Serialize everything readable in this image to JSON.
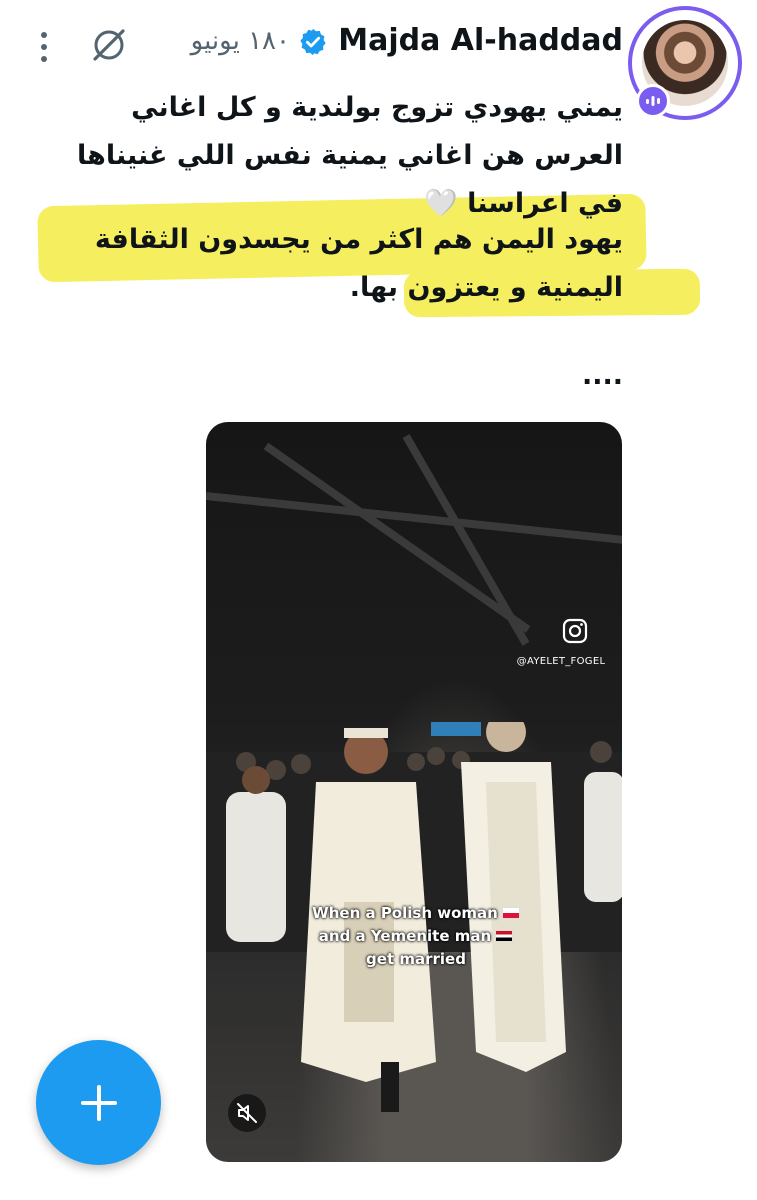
{
  "header": {
    "author_name": "Majda Al-haddad",
    "date": "١٨٠ يونيو",
    "avatar_icon": "profile-photo",
    "verified_icon": "verified-badge-icon",
    "grok_icon": "grok-icon",
    "more_icon": "more-vertical-icon",
    "space_icon": "spaces-live-icon"
  },
  "tweet": {
    "paragraph1": "يمني يهودي تزوج بولندية و كل اغاني العرس هن اغاني يمنية نفس اللي غنيناها في اعراسنا 🤍",
    "paragraph2": "يهود اليمن هم اكثر من يجسدون الثقافة اليمنية و يعتزون بها.",
    "paragraph3": "....",
    "highlight_color": "#f5ef5f"
  },
  "video": {
    "watermark_icon": "instagram-icon",
    "watermark_handle": "@AYELET_FOGEL",
    "caption_line1": "When a Polish woman",
    "caption_line2": "and a Yemenite man",
    "caption_line3": "get married",
    "mute_icon": "muted-speaker-icon"
  },
  "fab": {
    "icon": "plus-icon",
    "color": "#1d9bf0"
  },
  "colors": {
    "accent": "#1d9bf0",
    "space_ring": "#7b5cf0",
    "muted_text": "#536471"
  }
}
